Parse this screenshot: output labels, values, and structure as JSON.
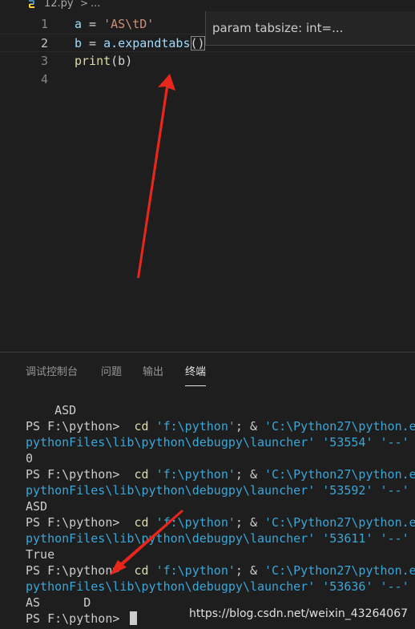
{
  "breadcrumb": {
    "file": "12.py",
    "separator": ">",
    "more": "..."
  },
  "editor": {
    "lines": [
      {
        "num": "1",
        "var": "a",
        "op": " = ",
        "str": "'AS\\tD'"
      },
      {
        "num": "2",
        "var": "b",
        "op": " = ",
        "expr": "a.expandtabs",
        "paren": "()"
      },
      {
        "num": "3",
        "fn": "print",
        "rest": "(b)"
      },
      {
        "num": "4"
      }
    ],
    "hover": "param tabsize: int=..."
  },
  "panel": {
    "tabs": [
      {
        "label": "调试控制台"
      },
      {
        "label": "问题"
      },
      {
        "label": "输出"
      },
      {
        "label": "终端"
      }
    ]
  },
  "terminal": {
    "line0": "    ASD",
    "prompt": "PS F:\\python> ",
    "cmd": " cd",
    "path1": "'f:\\python'",
    "amp": "; & ",
    "exe": "'C:\\Python27\\python.e",
    "launcher": "pythonFiles\\lib\\python\\debugpy\\launcher'",
    "port1": "'53554'",
    "port2": "'53592'",
    "port3": "'53611'",
    "port4": "'53636'",
    "dashes": " '--'",
    "out1": "0",
    "out2": "ASD",
    "out3": "True",
    "out4": "AS      D"
  },
  "watermark": "https://blog.csdn.net/weixin_43264067",
  "colors": {
    "background": "#1e1e1e",
    "arrow": "#e8261c",
    "string": "#ce9178",
    "function": "#dcdcaa"
  }
}
